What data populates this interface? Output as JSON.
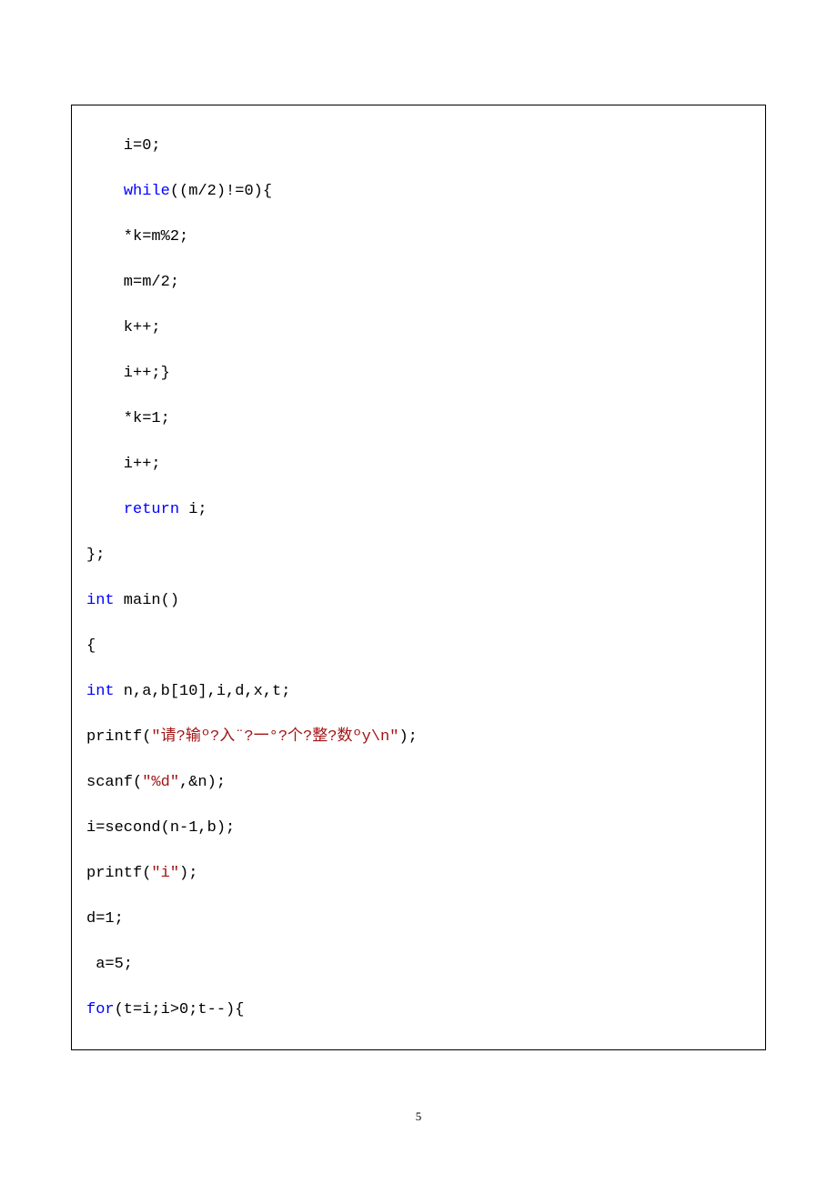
{
  "code": {
    "l1": "    i=0;",
    "l2a": "    ",
    "l2b": "while",
    "l2c": "((m/2)!=0){",
    "l3": "    *k=m%2;",
    "l4": "    m=m/2;",
    "l5": "    k++;",
    "l6": "    i++;}",
    "l7": "    *k=1;",
    "l8": "    i++;",
    "l9a": "    ",
    "l9b": "return",
    "l9c": " i;",
    "l10": "};",
    "l11": "",
    "l12a": "int",
    "l12b": " main()",
    "l13": "{",
    "l14": "",
    "l15a": "int",
    "l15b": " n,a,b[10],i,d,x,t;",
    "l16a": "printf(",
    "l16b": "\"请?输º?入¨?一°?个?整?数ºy\\n\"",
    "l16c": ");",
    "l17a": "scanf(",
    "l17b": "\"%d\"",
    "l17c": ",&n);",
    "l18": "i=second(n-1,b);",
    "l19a": "printf(",
    "l19b": "\"i\"",
    "l19c": ");",
    "l20": "d=1;",
    "l21": " a=5;",
    "l22a": "for",
    "l22b": "(t=i;i>0;t--){"
  },
  "pagenum": "5"
}
